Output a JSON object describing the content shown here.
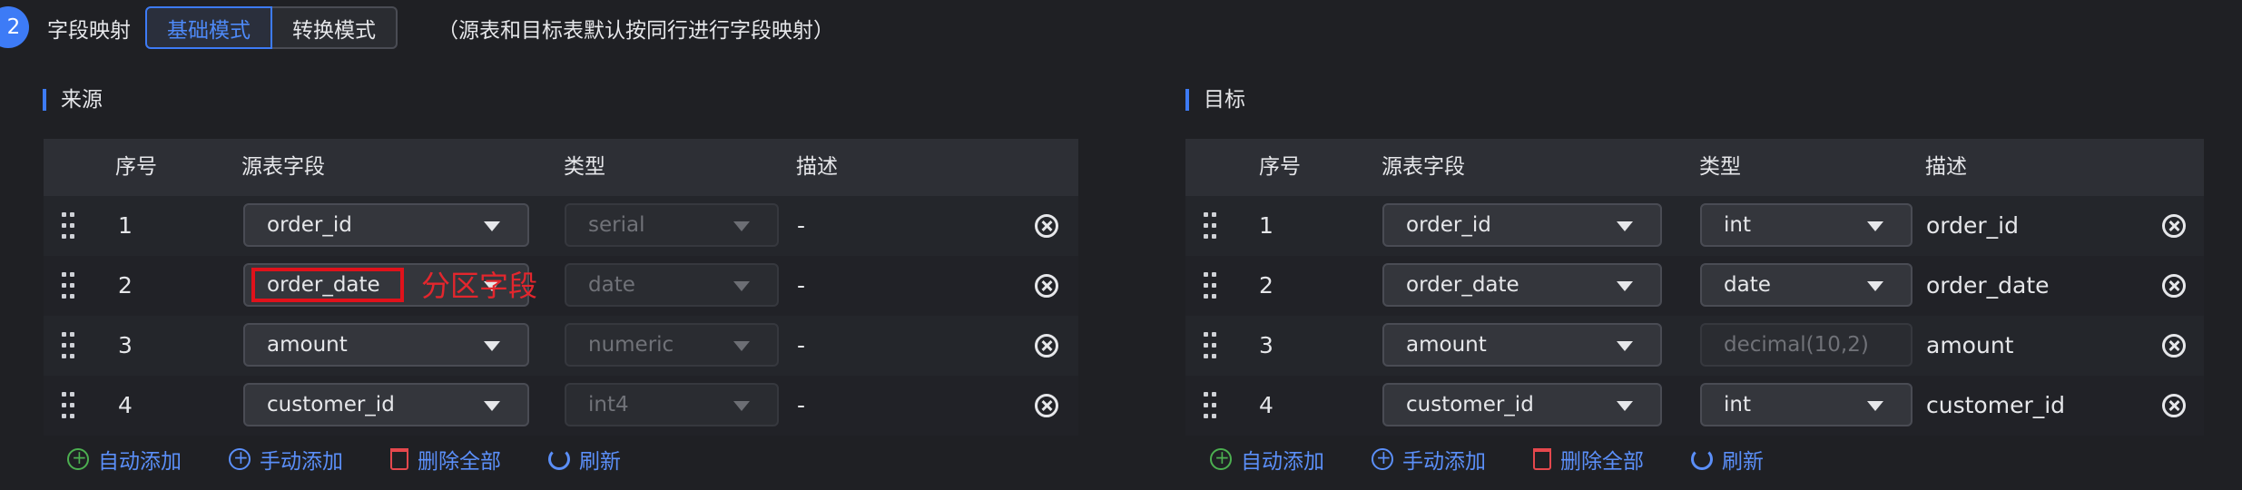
{
  "header": {
    "step": "2",
    "title": "字段映射",
    "modes": [
      "基础模式",
      "转换模式"
    ],
    "note": "（源表和目标表默认按同行进行字段映射）"
  },
  "columns": {
    "index": "序号",
    "field": "源表字段",
    "type": "类型",
    "desc": "描述"
  },
  "source": {
    "title": "来源",
    "rows": [
      {
        "index": "1",
        "field": "order_id",
        "type": "serial",
        "desc": "-"
      },
      {
        "index": "2",
        "field": "order_date",
        "type": "date",
        "desc": "-"
      },
      {
        "index": "3",
        "field": "amount",
        "type": "numeric",
        "desc": "-"
      },
      {
        "index": "4",
        "field": "customer_id",
        "type": "int4",
        "desc": "-"
      }
    ]
  },
  "target": {
    "title": "目标",
    "rows": [
      {
        "index": "1",
        "field": "order_id",
        "type": "int",
        "desc": "order_id"
      },
      {
        "index": "2",
        "field": "order_date",
        "type": "date",
        "desc": "order_date"
      },
      {
        "index": "3",
        "field": "amount",
        "type": "decimal(10,2)",
        "desc": "amount"
      },
      {
        "index": "4",
        "field": "customer_id",
        "type": "int",
        "desc": "customer_id"
      }
    ]
  },
  "actions": {
    "auto_add": "自动添加",
    "manual_add": "手动添加",
    "delete_all": "删除全部",
    "refresh": "刷新"
  },
  "annotation": {
    "label": "分区字段",
    "color": "#e0121b"
  },
  "colors": {
    "accent": "#3d7bf6",
    "link": "#5b8ff9",
    "danger": "#e5484d",
    "success": "#4caf50"
  },
  "icons": [
    "drag-handle-icon",
    "chevron-down-icon",
    "close-circle-icon",
    "plus-circle-icon",
    "trash-icon",
    "refresh-icon"
  ]
}
